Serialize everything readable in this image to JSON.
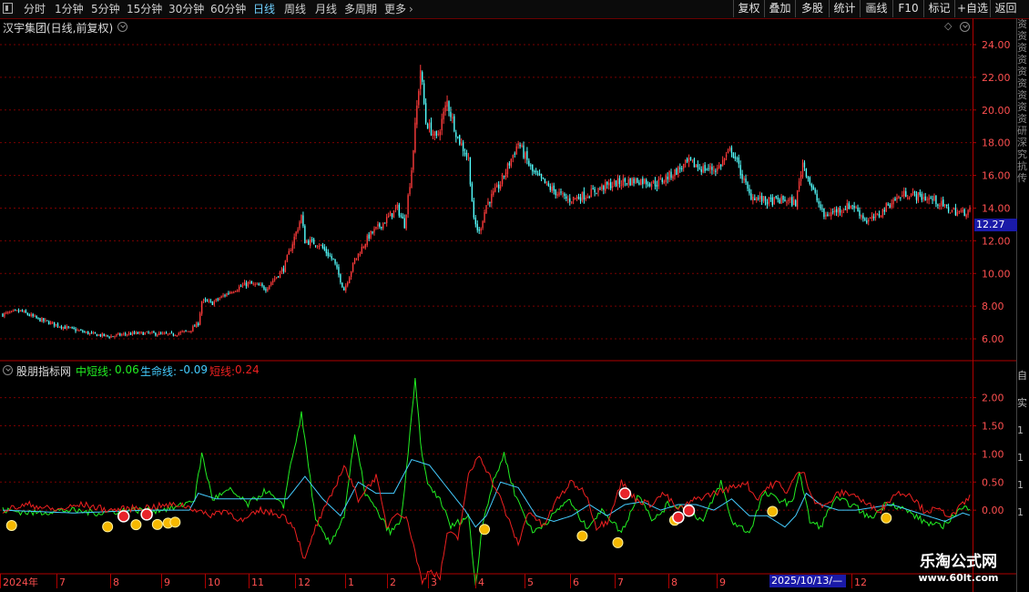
{
  "toolbar": {
    "periods": [
      "分时",
      "1分钟",
      "5分钟",
      "15分钟",
      "30分钟",
      "60分钟",
      "日线",
      "周线",
      "月线",
      "多周期",
      "更多"
    ],
    "active_period": "日线",
    "right_buttons": [
      "复权",
      "叠加",
      "多股",
      "统计",
      "画线",
      "F10",
      "标记",
      "+自选",
      "返回"
    ]
  },
  "main_chart": {
    "title": "汉宇集团(日线,前复权)",
    "current_price": "12.27",
    "y_ticks": [
      "24.00",
      "22.00",
      "20.00",
      "18.00",
      "16.00",
      "14.00",
      "12.00",
      "10.00",
      "8.00",
      "6.00"
    ]
  },
  "indicator": {
    "name": "股朋指标网",
    "zdx_label": "中短线:",
    "zdx_value": "0.06",
    "smx_label": "生命线:",
    "smx_value": "-0.09",
    "dx_label": "短线:",
    "dx_value": "0.24",
    "y_ticks": [
      "2.00",
      "1.50",
      "1.00",
      "0.50",
      "0.00"
    ]
  },
  "x_axis": {
    "labels": [
      "2024年",
      "7",
      "8",
      "9",
      "10",
      "11",
      "12",
      "1",
      "2",
      "3",
      "4",
      "5",
      "6",
      "7",
      "8",
      "9",
      "2025/10/13/—",
      "12"
    ]
  },
  "side_text": {
    "top": "资资资资资资资资资研深究抗传",
    "bottom": "自实1111"
  },
  "watermark": {
    "line1": "乐淘公式网",
    "line2": "www.60lt.com"
  },
  "colors": {
    "up": "#ff3b3b",
    "down": "#54ffff",
    "zdx": "#22ee22",
    "smx": "#44ccff",
    "dx": "#ee2020",
    "grid": "#7a0000",
    "axis": "#b00000",
    "price_ticks": "#ff5050",
    "active": "#6fd0ff"
  },
  "chart_data": [
    {
      "type": "candlestick",
      "title": "汉宇集团(日线,前复权)",
      "ylim": [
        5,
        24.5
      ],
      "last_close": 12.27,
      "close_path": [
        [
          0,
          7.5
        ],
        [
          10,
          7.7
        ],
        [
          20,
          7.2
        ],
        [
          35,
          6.7
        ],
        [
          50,
          6.3
        ],
        [
          60,
          6.15
        ],
        [
          70,
          6.3
        ],
        [
          80,
          6.35
        ],
        [
          95,
          6.25
        ],
        [
          105,
          6.5
        ],
        [
          110,
          6.95
        ],
        [
          112,
          8.3
        ],
        [
          118,
          8.2
        ],
        [
          128,
          8.9
        ],
        [
          138,
          9.4
        ],
        [
          148,
          9.1
        ],
        [
          158,
          10.3
        ],
        [
          165,
          12.5
        ],
        [
          168,
          13.5
        ],
        [
          170,
          12.0
        ],
        [
          178,
          11.8
        ],
        [
          186,
          10.8
        ],
        [
          192,
          9.0
        ],
        [
          198,
          10.8
        ],
        [
          206,
          12.3
        ],
        [
          214,
          13.1
        ],
        [
          222,
          14.0
        ],
        [
          226,
          13.0
        ],
        [
          230,
          16.4
        ],
        [
          233,
          20.2
        ],
        [
          235,
          22.5
        ],
        [
          238,
          19.3
        ],
        [
          244,
          18.2
        ],
        [
          250,
          20.5
        ],
        [
          256,
          18.3
        ],
        [
          262,
          17.0
        ],
        [
          265,
          13.2
        ],
        [
          268,
          12.5
        ],
        [
          272,
          14.2
        ],
        [
          280,
          15.5
        ],
        [
          290,
          18.0
        ],
        [
          298,
          16.2
        ],
        [
          308,
          15.2
        ],
        [
          318,
          14.5
        ],
        [
          328,
          14.8
        ],
        [
          338,
          15.3
        ],
        [
          348,
          15.6
        ],
        [
          358,
          15.7
        ],
        [
          368,
          15.5
        ],
        [
          378,
          16.2
        ],
        [
          386,
          16.8
        ],
        [
          394,
          16.4
        ],
        [
          402,
          16.4
        ],
        [
          410,
          17.6
        ],
        [
          414,
          16.5
        ],
        [
          420,
          14.8
        ],
        [
          430,
          14.4
        ],
        [
          440,
          14.5
        ],
        [
          446,
          14.3
        ],
        [
          450,
          16.8
        ],
        [
          456,
          15.0
        ],
        [
          462,
          13.5
        ],
        [
          470,
          13.9
        ],
        [
          478,
          14.2
        ],
        [
          486,
          13.2
        ],
        [
          492,
          13.5
        ],
        [
          500,
          14.4
        ],
        [
          508,
          14.9
        ],
        [
          516,
          14.7
        ],
        [
          524,
          14.5
        ],
        [
          532,
          13.9
        ],
        [
          540,
          13.7
        ],
        [
          544,
          13.9
        ]
      ]
    },
    {
      "type": "line",
      "title": "股朋指标网",
      "ylim": [
        -1.05,
        2.35
      ],
      "series": [
        {
          "name": "中短线",
          "values_path": [
            [
              0,
              0
            ],
            [
              18,
              -0.05
            ],
            [
              35,
              0
            ],
            [
              55,
              -0.05
            ],
            [
              70,
              0
            ],
            [
              86,
              0
            ],
            [
              98,
              0.05
            ],
            [
              108,
              0.2
            ],
            [
              112,
              1.0
            ],
            [
              118,
              0.2
            ],
            [
              128,
              0.35
            ],
            [
              138,
              0.1
            ],
            [
              148,
              0.35
            ],
            [
              158,
              0.05
            ],
            [
              160,
              0.5
            ],
            [
              166,
              1.4
            ],
            [
              168,
              1.7
            ],
            [
              172,
              0.8
            ],
            [
              176,
              -0.2
            ],
            [
              184,
              -0.6
            ],
            [
              192,
              -0.1
            ],
            [
              198,
              1.3
            ],
            [
              204,
              0.3
            ],
            [
              210,
              0.0
            ],
            [
              218,
              -0.4
            ],
            [
              224,
              -0.2
            ],
            [
              228,
              1.0
            ],
            [
              232,
              2.3
            ],
            [
              236,
              0.9
            ],
            [
              240,
              0.4
            ],
            [
              246,
              0.2
            ],
            [
              252,
              -0.3
            ],
            [
              262,
              -0.1
            ],
            [
              266,
              -1.35
            ],
            [
              270,
              -0.2
            ],
            [
              276,
              0.5
            ],
            [
              282,
              1.0
            ],
            [
              288,
              0.3
            ],
            [
              298,
              -0.4
            ],
            [
              308,
              -0.15
            ],
            [
              318,
              0.2
            ],
            [
              328,
              -0.3
            ],
            [
              338,
              0.0
            ],
            [
              348,
              -0.4
            ],
            [
              358,
              0.3
            ],
            [
              366,
              -0.2
            ],
            [
              374,
              0.1
            ],
            [
              384,
              0.05
            ],
            [
              394,
              -0.2
            ],
            [
              404,
              0.5
            ],
            [
              410,
              -0.2
            ],
            [
              420,
              -0.4
            ],
            [
              428,
              0.3
            ],
            [
              436,
              0.2
            ],
            [
              444,
              0.1
            ],
            [
              448,
              0.7
            ],
            [
              454,
              -0.2
            ],
            [
              460,
              -0.3
            ],
            [
              468,
              0.2
            ],
            [
              478,
              0.1
            ],
            [
              488,
              -0.15
            ],
            [
              498,
              0.15
            ],
            [
              508,
              0.0
            ],
            [
              518,
              -0.2
            ],
            [
              528,
              -0.3
            ],
            [
              538,
              0.0
            ],
            [
              544,
              0.06
            ]
          ]
        },
        {
          "name": "生命线",
          "values_path": [
            [
              0,
              0
            ],
            [
              40,
              -0.05
            ],
            [
              80,
              0.0
            ],
            [
              105,
              0.0
            ],
            [
              110,
              0.3
            ],
            [
              120,
              0.2
            ],
            [
              140,
              0.2
            ],
            [
              160,
              0.2
            ],
            [
              170,
              0.6
            ],
            [
              180,
              0.2
            ],
            [
              190,
              -0.1
            ],
            [
              200,
              0.5
            ],
            [
              210,
              0.3
            ],
            [
              220,
              0.3
            ],
            [
              230,
              0.9
            ],
            [
              240,
              0.8
            ],
            [
              250,
              0.4
            ],
            [
              260,
              0.0
            ],
            [
              266,
              -0.3
            ],
            [
              272,
              -0.1
            ],
            [
              280,
              0.5
            ],
            [
              290,
              0.4
            ],
            [
              300,
              -0.1
            ],
            [
              310,
              -0.2
            ],
            [
              320,
              -0.1
            ],
            [
              330,
              0.1
            ],
            [
              340,
              -0.1
            ],
            [
              350,
              0.1
            ],
            [
              360,
              0.15
            ],
            [
              370,
              0.0
            ],
            [
              380,
              0.1
            ],
            [
              390,
              0.1
            ],
            [
              400,
              0.0
            ],
            [
              410,
              0.2
            ],
            [
              420,
              -0.1
            ],
            [
              430,
              -0.1
            ],
            [
              440,
              -0.3
            ],
            [
              446,
              -0.1
            ],
            [
              452,
              0.3
            ],
            [
              460,
              0.1
            ],
            [
              470,
              0.0
            ],
            [
              480,
              0.0
            ],
            [
              490,
              0.05
            ],
            [
              500,
              0.1
            ],
            [
              510,
              0.0
            ],
            [
              520,
              -0.1
            ],
            [
              530,
              -0.2
            ],
            [
              540,
              -0.05
            ],
            [
              544,
              -0.09
            ]
          ]
        },
        {
          "name": "短线",
          "values_path": [
            [
              0,
              0
            ],
            [
              15,
              0.1
            ],
            [
              30,
              0.0
            ],
            [
              45,
              0.1
            ],
            [
              60,
              0.0
            ],
            [
              80,
              0.05
            ],
            [
              100,
              0.1
            ],
            [
              110,
              0.0
            ],
            [
              115,
              -0.1
            ],
            [
              125,
              0.0
            ],
            [
              135,
              -0.2
            ],
            [
              145,
              0.0
            ],
            [
              158,
              -0.1
            ],
            [
              164,
              -0.3
            ],
            [
              170,
              -0.9
            ],
            [
              176,
              -0.3
            ],
            [
              184,
              0.2
            ],
            [
              192,
              0.8
            ],
            [
              200,
              0.2
            ],
            [
              210,
              0.6
            ],
            [
              216,
              -0.3
            ],
            [
              222,
              0.0
            ],
            [
              228,
              -0.2
            ],
            [
              236,
              -1.3
            ],
            [
              240,
              -1.05
            ],
            [
              246,
              -1.2
            ],
            [
              250,
              -0.4
            ],
            [
              256,
              -0.5
            ],
            [
              262,
              0.6
            ],
            [
              268,
              1.0
            ],
            [
              274,
              0.6
            ],
            [
              280,
              0.2
            ],
            [
              286,
              -0.3
            ],
            [
              290,
              -0.6
            ],
            [
              296,
              0.0
            ],
            [
              304,
              -0.3
            ],
            [
              312,
              0.2
            ],
            [
              320,
              0.5
            ],
            [
              328,
              0.3
            ],
            [
              334,
              -0.3
            ],
            [
              340,
              -0.2
            ],
            [
              348,
              0.5
            ],
            [
              356,
              0.2
            ],
            [
              364,
              0.1
            ],
            [
              372,
              0.3
            ],
            [
              380,
              0.0
            ],
            [
              390,
              0.2
            ],
            [
              400,
              0.3
            ],
            [
              410,
              0.4
            ],
            [
              418,
              0.5
            ],
            [
              424,
              0.2
            ],
            [
              430,
              0.4
            ],
            [
              436,
              0.5
            ],
            [
              440,
              0.3
            ],
            [
              446,
              0.6
            ],
            [
              450,
              0.7
            ],
            [
              456,
              0.2
            ],
            [
              462,
              0.05
            ],
            [
              470,
              0.3
            ],
            [
              478,
              0.3
            ],
            [
              486,
              0.1
            ],
            [
              494,
              0.0
            ],
            [
              502,
              0.3
            ],
            [
              510,
              0.3
            ],
            [
              518,
              0.0
            ],
            [
              526,
              0.0
            ],
            [
              534,
              -0.1
            ],
            [
              540,
              0.1
            ],
            [
              544,
              0.24
            ]
          ]
        }
      ],
      "buy_markers": [
        5,
        59,
        75,
        87,
        93,
        97,
        271,
        326,
        346,
        378,
        433,
        497
      ],
      "sell_markers": [
        68,
        81,
        350,
        380,
        386
      ]
    }
  ]
}
